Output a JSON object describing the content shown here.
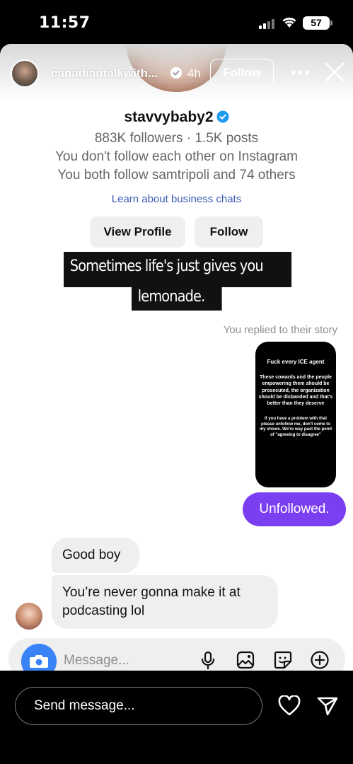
{
  "status_bar": {
    "time": "11:57",
    "battery": "57"
  },
  "story_header": {
    "username": "canadiantalkwith...",
    "age": "4h",
    "follow_label": "Follow",
    "more_label": "•••"
  },
  "profile": {
    "name": "stavvybaby2",
    "stats": "883K followers · 1.5K posts",
    "relation1": "You don't follow each other on Instagram",
    "relation2": "You both follow samtripoli and 74 others",
    "learn_link": "Learn about business chats",
    "view_profile_label": "View Profile",
    "follow_label": "Follow"
  },
  "caption": {
    "line1": "Sometimes life's just gives you",
    "line2": "lemonade."
  },
  "thread": {
    "replied_note": "You replied to their story",
    "story_preview": {
      "title": "Fuck every ICE agent",
      "body": "These cowards and the people empowering them should be prosecuted, the organization should be disbanded and that's better than they deserve",
      "footer": "If you have a problem with that please unfollow me, don't come to my shows. We're way past the point of \"agreeing to disagree\""
    },
    "my_message": "Unfollowed.",
    "their_messages": [
      "Good boy",
      "You’re never gonna make it at podcasting lol"
    ]
  },
  "composer": {
    "placeholder": "Message..."
  },
  "bottom_bar": {
    "send_placeholder": "Send message..."
  },
  "colors": {
    "accent_purple": "#7b3ff2",
    "camera_blue": "#3a83f7",
    "verified_blue": "#1d9bf0"
  }
}
